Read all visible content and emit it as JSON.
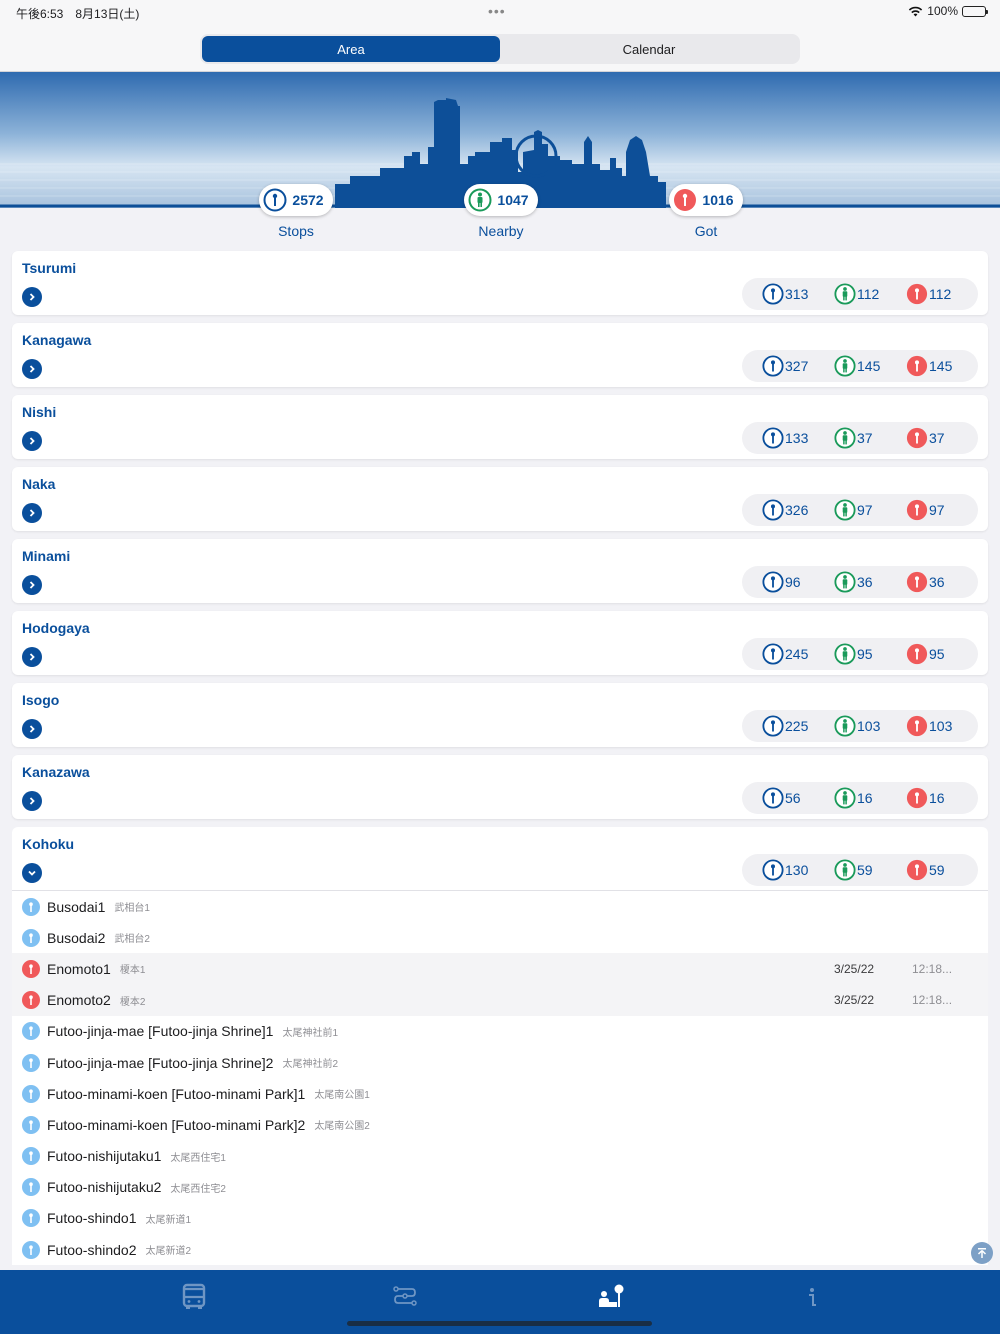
{
  "status": {
    "time": "午後6:53　8月13日(土)",
    "battery": "100%"
  },
  "segments": [
    {
      "label": "Area",
      "active": true
    },
    {
      "label": "Calendar",
      "active": false
    }
  ],
  "summary": [
    {
      "value": "2572",
      "label": "Stops",
      "icon": "bus-stop-outline-icon"
    },
    {
      "value": "1047",
      "label": "Nearby",
      "icon": "person-nearby-icon"
    },
    {
      "value": "1016",
      "label": "Got",
      "icon": "bus-stop-got-icon"
    }
  ],
  "areas": [
    {
      "name": "Tsurumi",
      "stops": "313",
      "nearby": "112",
      "got": "112"
    },
    {
      "name": "Kanagawa",
      "stops": "327",
      "nearby": "145",
      "got": "145"
    },
    {
      "name": "Nishi",
      "stops": "133",
      "nearby": "37",
      "got": "37"
    },
    {
      "name": "Naka",
      "stops": "326",
      "nearby": "97",
      "got": "97"
    },
    {
      "name": "Minami",
      "stops": "96",
      "nearby": "36",
      "got": "36"
    },
    {
      "name": "Hodogaya",
      "stops": "245",
      "nearby": "95",
      "got": "95"
    },
    {
      "name": "Isogo",
      "stops": "225",
      "nearby": "103",
      "got": "103"
    },
    {
      "name": "Kanazawa",
      "stops": "56",
      "nearby": "16",
      "got": "16"
    }
  ],
  "expanded_area": {
    "name": "Kohoku",
    "stops": "130",
    "nearby": "59",
    "got": "59"
  },
  "stops": [
    {
      "name": "Busodai1",
      "jp": "武相台1",
      "got": false,
      "date": "",
      "time": ""
    },
    {
      "name": "Busodai2",
      "jp": "武相台2",
      "got": false,
      "date": "",
      "time": ""
    },
    {
      "name": "Enomoto1",
      "jp": "榎本1",
      "got": true,
      "date": "3/25/22",
      "time": "12:18..."
    },
    {
      "name": "Enomoto2",
      "jp": "榎本2",
      "got": true,
      "date": "3/25/22",
      "time": "12:18..."
    },
    {
      "name": "Futoo-jinja-mae [Futoo-jinja Shrine]1",
      "jp": "太尾神社前1",
      "got": false,
      "date": "",
      "time": ""
    },
    {
      "name": "Futoo-jinja-mae [Futoo-jinja Shrine]2",
      "jp": "太尾神社前2",
      "got": false,
      "date": "",
      "time": ""
    },
    {
      "name": "Futoo-minami-koen [Futoo-minami Park]1",
      "jp": "太尾南公園1",
      "got": false,
      "date": "",
      "time": ""
    },
    {
      "name": "Futoo-minami-koen [Futoo-minami Park]2",
      "jp": "太尾南公園2",
      "got": false,
      "date": "",
      "time": ""
    },
    {
      "name": "Futoo-nishijutaku1",
      "jp": "太尾西住宅1",
      "got": false,
      "date": "",
      "time": ""
    },
    {
      "name": "Futoo-nishijutaku2",
      "jp": "太尾西住宅2",
      "got": false,
      "date": "",
      "time": ""
    },
    {
      "name": "Futoo-shindo1",
      "jp": "太尾新道1",
      "got": false,
      "date": "",
      "time": ""
    },
    {
      "name": "Futoo-shindo2",
      "jp": "太尾新道2",
      "got": false,
      "date": "",
      "time": ""
    }
  ],
  "tabs": [
    {
      "icon": "bus-icon",
      "active": false
    },
    {
      "icon": "route-icon",
      "active": false
    },
    {
      "icon": "collection-icon",
      "active": true
    },
    {
      "icon": "info-icon",
      "active": false
    }
  ],
  "colors": {
    "primary": "#0a4f9c",
    "nearby": "#1a9a5a",
    "got": "#f0595a",
    "stop_light": "#7fc0f2"
  }
}
